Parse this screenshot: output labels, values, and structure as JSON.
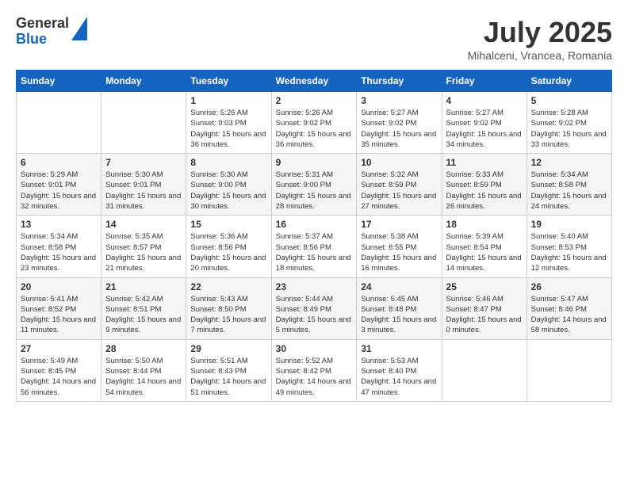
{
  "header": {
    "logo_general": "General",
    "logo_blue": "Blue",
    "month": "July 2025",
    "location": "Mihalceni, Vrancea, Romania"
  },
  "weekdays": [
    "Sunday",
    "Monday",
    "Tuesday",
    "Wednesday",
    "Thursday",
    "Friday",
    "Saturday"
  ],
  "weeks": [
    [
      {
        "day": "",
        "info": ""
      },
      {
        "day": "",
        "info": ""
      },
      {
        "day": "1",
        "info": "Sunrise: 5:26 AM\nSunset: 9:03 PM\nDaylight: 15 hours and 36 minutes."
      },
      {
        "day": "2",
        "info": "Sunrise: 5:26 AM\nSunset: 9:02 PM\nDaylight: 15 hours and 36 minutes."
      },
      {
        "day": "3",
        "info": "Sunrise: 5:27 AM\nSunset: 9:02 PM\nDaylight: 15 hours and 35 minutes."
      },
      {
        "day": "4",
        "info": "Sunrise: 5:27 AM\nSunset: 9:02 PM\nDaylight: 15 hours and 34 minutes."
      },
      {
        "day": "5",
        "info": "Sunrise: 5:28 AM\nSunset: 9:02 PM\nDaylight: 15 hours and 33 minutes."
      }
    ],
    [
      {
        "day": "6",
        "info": "Sunrise: 5:29 AM\nSunset: 9:01 PM\nDaylight: 15 hours and 32 minutes."
      },
      {
        "day": "7",
        "info": "Sunrise: 5:30 AM\nSunset: 9:01 PM\nDaylight: 15 hours and 31 minutes."
      },
      {
        "day": "8",
        "info": "Sunrise: 5:30 AM\nSunset: 9:00 PM\nDaylight: 15 hours and 30 minutes."
      },
      {
        "day": "9",
        "info": "Sunrise: 5:31 AM\nSunset: 9:00 PM\nDaylight: 15 hours and 28 minutes."
      },
      {
        "day": "10",
        "info": "Sunrise: 5:32 AM\nSunset: 8:59 PM\nDaylight: 15 hours and 27 minutes."
      },
      {
        "day": "11",
        "info": "Sunrise: 5:33 AM\nSunset: 8:59 PM\nDaylight: 15 hours and 26 minutes."
      },
      {
        "day": "12",
        "info": "Sunrise: 5:34 AM\nSunset: 8:58 PM\nDaylight: 15 hours and 24 minutes."
      }
    ],
    [
      {
        "day": "13",
        "info": "Sunrise: 5:34 AM\nSunset: 8:58 PM\nDaylight: 15 hours and 23 minutes."
      },
      {
        "day": "14",
        "info": "Sunrise: 5:35 AM\nSunset: 8:57 PM\nDaylight: 15 hours and 21 minutes."
      },
      {
        "day": "15",
        "info": "Sunrise: 5:36 AM\nSunset: 8:56 PM\nDaylight: 15 hours and 20 minutes."
      },
      {
        "day": "16",
        "info": "Sunrise: 5:37 AM\nSunset: 8:56 PM\nDaylight: 15 hours and 18 minutes."
      },
      {
        "day": "17",
        "info": "Sunrise: 5:38 AM\nSunset: 8:55 PM\nDaylight: 15 hours and 16 minutes."
      },
      {
        "day": "18",
        "info": "Sunrise: 5:39 AM\nSunset: 8:54 PM\nDaylight: 15 hours and 14 minutes."
      },
      {
        "day": "19",
        "info": "Sunrise: 5:40 AM\nSunset: 8:53 PM\nDaylight: 15 hours and 12 minutes."
      }
    ],
    [
      {
        "day": "20",
        "info": "Sunrise: 5:41 AM\nSunset: 8:52 PM\nDaylight: 15 hours and 11 minutes."
      },
      {
        "day": "21",
        "info": "Sunrise: 5:42 AM\nSunset: 8:51 PM\nDaylight: 15 hours and 9 minutes."
      },
      {
        "day": "22",
        "info": "Sunrise: 5:43 AM\nSunset: 8:50 PM\nDaylight: 15 hours and 7 minutes."
      },
      {
        "day": "23",
        "info": "Sunrise: 5:44 AM\nSunset: 8:49 PM\nDaylight: 15 hours and 5 minutes."
      },
      {
        "day": "24",
        "info": "Sunrise: 5:45 AM\nSunset: 8:48 PM\nDaylight: 15 hours and 3 minutes."
      },
      {
        "day": "25",
        "info": "Sunrise: 5:46 AM\nSunset: 8:47 PM\nDaylight: 15 hours and 0 minutes."
      },
      {
        "day": "26",
        "info": "Sunrise: 5:47 AM\nSunset: 8:46 PM\nDaylight: 14 hours and 58 minutes."
      }
    ],
    [
      {
        "day": "27",
        "info": "Sunrise: 5:49 AM\nSunset: 8:45 PM\nDaylight: 14 hours and 56 minutes."
      },
      {
        "day": "28",
        "info": "Sunrise: 5:50 AM\nSunset: 8:44 PM\nDaylight: 14 hours and 54 minutes."
      },
      {
        "day": "29",
        "info": "Sunrise: 5:51 AM\nSunset: 8:43 PM\nDaylight: 14 hours and 51 minutes."
      },
      {
        "day": "30",
        "info": "Sunrise: 5:52 AM\nSunset: 8:42 PM\nDaylight: 14 hours and 49 minutes."
      },
      {
        "day": "31",
        "info": "Sunrise: 5:53 AM\nSunset: 8:40 PM\nDaylight: 14 hours and 47 minutes."
      },
      {
        "day": "",
        "info": ""
      },
      {
        "day": "",
        "info": ""
      }
    ]
  ]
}
